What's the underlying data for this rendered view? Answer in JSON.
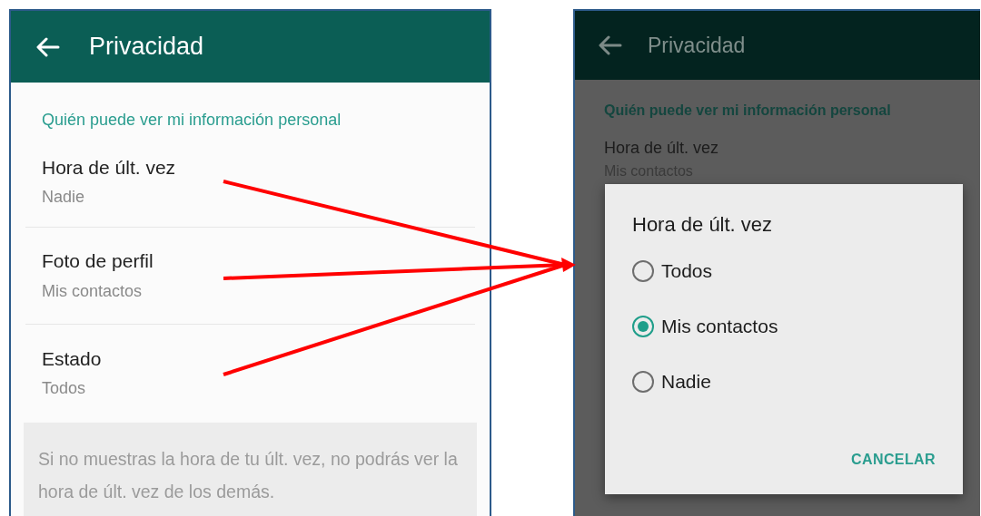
{
  "settings_screen": {
    "header": {
      "title": "Privacidad"
    },
    "section_title": "Quién puede ver mi información personal",
    "items": [
      {
        "title": "Hora de últ. vez",
        "value": "Nadie"
      },
      {
        "title": "Foto de perfil",
        "value": "Mis contactos"
      },
      {
        "title": "Estado",
        "value": "Todos"
      }
    ],
    "info_text": "Si no muestras la hora de tu últ. vez, no podrás ver la hora de últ. vez de los demás."
  },
  "dialog_screen": {
    "header": {
      "title": "Privacidad"
    },
    "section_title": "Quién puede ver mi información personal",
    "items": [
      {
        "title": "Hora de últ. vez",
        "value": "Mis contactos"
      }
    ],
    "dialog": {
      "title": "Hora de últ. vez",
      "options": [
        {
          "label": "Todos",
          "selected": false
        },
        {
          "label": "Mis contactos",
          "selected": true
        },
        {
          "label": "Nadie",
          "selected": false
        }
      ],
      "button": "CANCELAR"
    }
  }
}
